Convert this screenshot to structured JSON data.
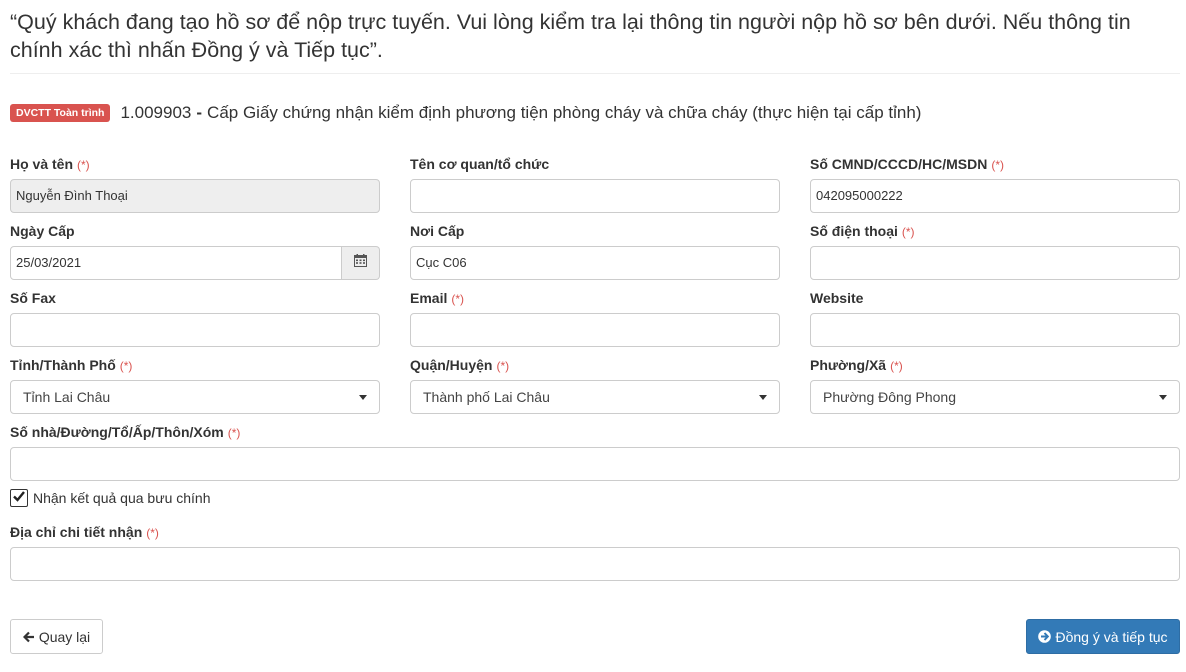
{
  "notice": "“Quý khách đang tạo hồ sơ để nộp trực tuyến. Vui lòng kiểm tra lại thông tin người nộp hồ sơ bên dưới. Nếu thông tin chính xác thì nhấn Đồng ý và Tiếp tục”.",
  "procedure": {
    "badge": "DVCTT Toàn trình",
    "code": "1.009903",
    "separator": "-",
    "name": "Cấp Giấy chứng nhận kiểm định phương tiện phòng cháy và chữa cháy (thực hiện tại cấp tỉnh)"
  },
  "required_mark": "(*)",
  "form": {
    "full_name": {
      "label": "Họ và tên",
      "value": "Nguyễn Đình Thoại"
    },
    "organization": {
      "label": "Tên cơ quan/tổ chức",
      "value": ""
    },
    "id_number": {
      "label": "Số CMND/CCCD/HC/MSDN",
      "value": "042095000222"
    },
    "issue_date": {
      "label": "Ngày Cấp",
      "value": "25/03/2021",
      "icon": "calendar-icon"
    },
    "issue_place": {
      "label": "Nơi Cấp",
      "value": "Cục C06"
    },
    "phone": {
      "label": "Số điện thoại",
      "value": ""
    },
    "fax": {
      "label": "Số Fax",
      "value": ""
    },
    "email": {
      "label": "Email",
      "value": ""
    },
    "website": {
      "label": "Website",
      "value": ""
    },
    "province": {
      "label": "Tỉnh/Thành Phố",
      "value": "Tỉnh Lai Châu"
    },
    "district": {
      "label": "Quận/Huyện",
      "value": "Thành phố Lai Châu"
    },
    "ward": {
      "label": "Phường/Xã",
      "value": "Phường Đông Phong"
    },
    "street": {
      "label": "Số nhà/Đường/Tổ/Ấp/Thôn/Xóm",
      "value": ""
    },
    "postal_checkbox": {
      "label": "Nhận kết quả qua bưu chính",
      "checked": true
    },
    "delivery_address": {
      "label": "Địa chỉ chi tiết nhận",
      "value": ""
    }
  },
  "buttons": {
    "back": {
      "label": "Quay lại",
      "icon": "arrow-left-icon"
    },
    "next": {
      "label": "Đồng ý và tiếp tục",
      "icon": "arrow-circle-right-icon"
    }
  },
  "colors": {
    "required": "#d9534f",
    "badge": "#d9534f",
    "primary": "#337ab7",
    "readonly_bg": "#eeeeee"
  }
}
